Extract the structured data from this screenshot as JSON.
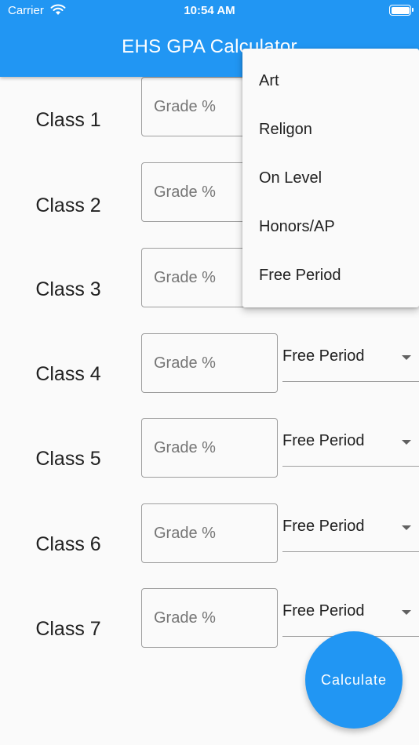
{
  "status_bar": {
    "carrier": "Carrier",
    "time": "10:54 AM",
    "icons": [
      "wifi-icon",
      "battery-icon"
    ]
  },
  "app_bar": {
    "title": "EHS GPA Calculator"
  },
  "classes": [
    {
      "label": "Class 1",
      "grade_placeholder": "Grade %",
      "selected": ""
    },
    {
      "label": "Class 2",
      "grade_placeholder": "Grade %",
      "selected": ""
    },
    {
      "label": "Class 3",
      "grade_placeholder": "Grade %",
      "selected": ""
    },
    {
      "label": "Class 4",
      "grade_placeholder": "Grade %",
      "selected": "Free Period"
    },
    {
      "label": "Class 5",
      "grade_placeholder": "Grade %",
      "selected": "Free Period"
    },
    {
      "label": "Class 6",
      "grade_placeholder": "Grade %",
      "selected": "Free Period"
    },
    {
      "label": "Class 7",
      "grade_placeholder": "Grade %",
      "selected": "Free Period"
    }
  ],
  "dropdown_menu": {
    "options": [
      "Art",
      "Religon",
      "On Level",
      "Honors/AP",
      "Free Period"
    ]
  },
  "fab": {
    "label": "Calculate"
  },
  "colors": {
    "primary": "#2196f3",
    "background": "#fafafa",
    "text": "#212121",
    "border": "#9e9e9e"
  }
}
